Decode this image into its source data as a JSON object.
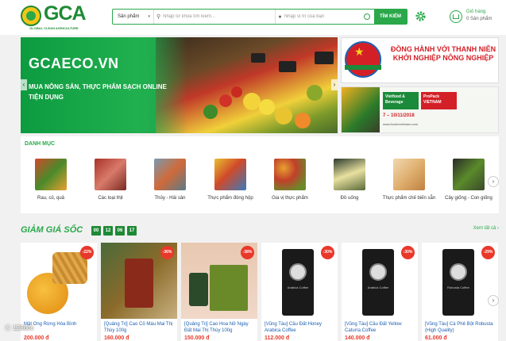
{
  "header": {
    "logo_text": "GCA",
    "logo_sub": "GLOBAL CLEAN AGRICULTURE",
    "category_select": "Sản phẩm",
    "keyword_placeholder": "Nhập từ khóa tìm kiếm...",
    "location_placeholder": "Nhập vị trí của bạn",
    "search_button": "TÌM KIẾM",
    "cart_label": "Giỏ hàng",
    "cart_count": "0 Sản phẩm"
  },
  "banner": {
    "title": "GCAECO.VN",
    "subtitle": "MUA NÔNG SẢN, THỰC PHẨM SẠCH ONLINE TIỆN DỤNG",
    "right_top_text": "ĐỒNG HÀNH VỚI THANH NIÊN KHỞI NGHIỆP NÔNG NGHIỆP",
    "right_bottom_logo1": "Vietfood & Beverage",
    "right_bottom_logo2": "ProPack VIETNAM",
    "right_bottom_date": "7 – 10/11/2018",
    "right_bottom_site": "www.foodexvietnam.com"
  },
  "categories": {
    "title": "DANH MỤC",
    "items": [
      {
        "label": "Rau, củ, quả"
      },
      {
        "label": "Các loại thịt"
      },
      {
        "label": "Thủy - Hải sản"
      },
      {
        "label": "Thực phẩm đóng hộp"
      },
      {
        "label": "Gia vị thực phẩm"
      },
      {
        "label": "Đồ uống"
      },
      {
        "label": "Thực phẩm chế biến sẵn"
      },
      {
        "label": "Cây giống - Con giống"
      }
    ],
    "next": "›"
  },
  "flash_sale": {
    "title": "GIẢM GIÁ SỐC",
    "timer": [
      "00",
      "12",
      "06",
      "17"
    ],
    "see_all": "Xem tất cả ›"
  },
  "products": [
    {
      "name": "Mật Ong Rừng Hòa Bình",
      "price": "200.000 đ",
      "discount": "-22%"
    },
    {
      "name": "[Quảng Trị] Cao Cỏ Máu Mai Thị Thùy 100g",
      "price": "160.000 đ",
      "discount": "-36%"
    },
    {
      "name": "[Quảng Trị] Cao Hoa Nở Ngày Đất Mai Thị Thùy 100g",
      "price": "150.000 đ",
      "discount": "-38%"
    },
    {
      "name": "[Vũng Tàu] Cầu Đất Honey Arabica Coffee",
      "price": "112.000 đ",
      "discount": "-30%"
    },
    {
      "name": "[Vũng Tàu] Cầu Đất Yellow Caturra Coffee",
      "price": "140.000 đ",
      "discount": "-30%"
    },
    {
      "name": "[Vũng Tàu] Cà Phê Bột Robusta (High Quality)",
      "price": "61.000 đ",
      "discount": "-29%"
    }
  ],
  "watermark": "ⓒ 123doc"
}
